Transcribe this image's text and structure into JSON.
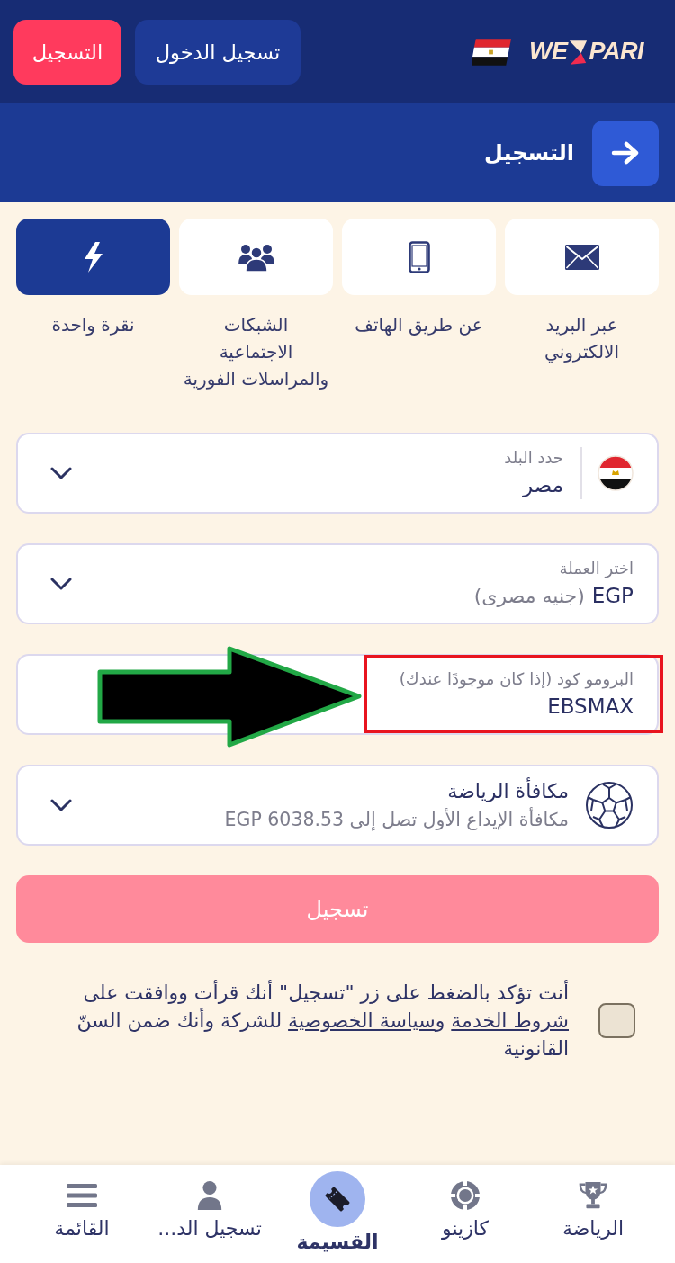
{
  "header": {
    "logo": {
      "left": "WE",
      "right": "PARI"
    },
    "login_button": "تسجيل الدخول",
    "register_button": "التسجيل"
  },
  "page_title": "التسجيل",
  "methods": [
    {
      "kind": "email",
      "label": "عبر البريد\nالالكتروني",
      "selected": false
    },
    {
      "kind": "phone",
      "label": "عن طريق الهاتف",
      "selected": false
    },
    {
      "kind": "social",
      "label": "الشبكات\nالاجتماعية\nوالمراسلات الفورية",
      "selected": false
    },
    {
      "kind": "oneclick",
      "label": "نقرة واحدة",
      "selected": true
    }
  ],
  "fields": [
    {
      "kind": "country",
      "label": "حدد البلد",
      "value": "مصر"
    },
    {
      "kind": "currency",
      "label": "اختر العملة",
      "value": "EGP",
      "note": "(جنيه مصرى)"
    },
    {
      "kind": "promo",
      "label": "البرومو كود (إذا كان موجودًا عندك)",
      "value": "EBSMAX",
      "annotated": true
    },
    {
      "kind": "bonus",
      "title": "مكافأة الرياضة",
      "subtitle": "مكافأة الإيداع الأول تصل إلى EGP 6038.53"
    }
  ],
  "register_button": {
    "label": "تسجيل",
    "disabled": true
  },
  "terms": {
    "checked": false,
    "segments": [
      {
        "kind": "text",
        "text": "أنت تؤكد بالضغط على زر \"تسجيل\" أنك قرأت ووافقت على "
      },
      {
        "kind": "link",
        "text": "شروط الخدمة"
      },
      {
        "kind": "text",
        "text": " و"
      },
      {
        "kind": "link",
        "text": "سياسة الخصوصية"
      },
      {
        "kind": "text",
        "text": " للشركة وأنك ضمن السنّ القانونية"
      }
    ]
  },
  "nav": [
    {
      "kind": "trophy",
      "label": "الرياضة",
      "selected": false
    },
    {
      "kind": "chip",
      "label": "كازينو",
      "selected": false
    },
    {
      "kind": "ticket",
      "label": "القسيمة",
      "selected": true
    },
    {
      "kind": "person",
      "label": "تسجيل الد...",
      "selected": false
    },
    {
      "kind": "menu",
      "label": "القائمة",
      "selected": false
    }
  ]
}
